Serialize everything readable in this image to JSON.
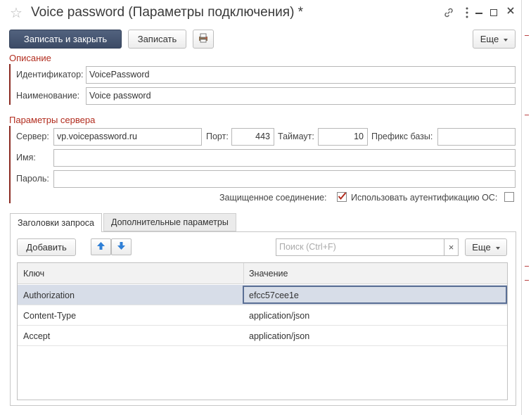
{
  "window": {
    "title": "Voice password (Параметры подключения) *"
  },
  "toolbar": {
    "save_close_label": "Записать и закрыть",
    "save_label": "Записать",
    "more_label": "Еще"
  },
  "description_section": {
    "title": "Описание",
    "identifier_label": "Идентификатор:",
    "identifier_value": "VoicePassword",
    "name_label": "Наименование:",
    "name_value": "Voice password"
  },
  "server_section": {
    "title": "Параметры сервера",
    "server_label": "Сервер:",
    "server_value": "vp.voicepassword.ru",
    "port_label": "Порт:",
    "port_value": "443",
    "timeout_label": "Таймаут:",
    "timeout_value": "10",
    "prefix_label": "Префикс базы:",
    "prefix_value": "",
    "user_label": "Имя:",
    "user_value": "",
    "password_label": "Пароль:",
    "password_value": "",
    "secure_label": "Защищенное соединение:",
    "secure_checked": true,
    "os_auth_label": "Использовать аутентификацию ОС:",
    "os_auth_checked": false
  },
  "tabs": [
    {
      "label": "Заголовки запроса",
      "active": true
    },
    {
      "label": "Дополнительные параметры",
      "active": false
    }
  ],
  "headers_panel": {
    "add_label": "Добавить",
    "search_placeholder": "Поиск (Ctrl+F)",
    "more_label": "Еще",
    "columns": [
      "Ключ",
      "Значение"
    ],
    "rows": [
      {
        "key": "Authorization",
        "value": "efcc57cee1e",
        "selected": true
      },
      {
        "key": "Content-Type",
        "value": "application/json",
        "selected": false
      },
      {
        "key": "Accept",
        "value": "application/json",
        "selected": false
      }
    ]
  },
  "colors": {
    "accent_dark": "#3c4b66",
    "section_title": "#b22d1f",
    "selected_row": "#d7dde8",
    "arrow_blue": "#2f7fd6",
    "check_red": "#b22d1f"
  }
}
